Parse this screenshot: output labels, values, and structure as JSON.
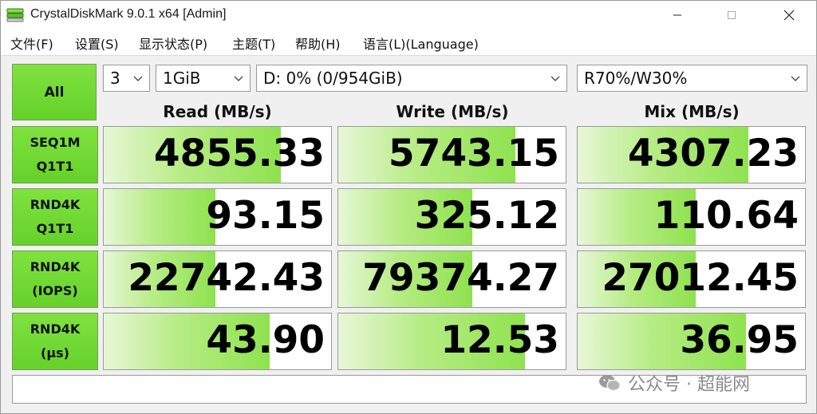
{
  "window": {
    "title": "CrystalDiskMark 9.0.1 x64 [Admin]"
  },
  "menu": {
    "items": [
      "文件(F)",
      "设置(S)",
      "显示状态(P)",
      "主题(T)",
      "帮助(H)",
      "语言(L)(Language)"
    ]
  },
  "controls": {
    "all_label": "All",
    "count": "3",
    "size": "1GiB",
    "drive": "D: 0% (0/954GiB)",
    "mix": "R70%/W30%"
  },
  "headers": {
    "read": "Read (MB/s)",
    "write": "Write (MB/s)",
    "mix": "Mix (MB/s)"
  },
  "rows": [
    {
      "line1": "SEQ1M",
      "line2": "Q1T1",
      "read": "4855.33",
      "write": "5743.15",
      "mix": "4307.23",
      "read_fill": 0.78,
      "write_fill": 0.78,
      "mix_fill": 0.75
    },
    {
      "line1": "RND4K",
      "line2": "Q1T1",
      "read": "93.15",
      "write": "325.12",
      "mix": "110.64",
      "read_fill": 0.49,
      "write_fill": 0.59,
      "mix_fill": 0.52
    },
    {
      "line1": "RND4K",
      "line2": "(IOPS)",
      "read": "22742.43",
      "write": "79374.27",
      "mix": "27012.45",
      "read_fill": 0.49,
      "write_fill": 0.59,
      "mix_fill": 0.52
    },
    {
      "line1": "RND4K",
      "line2": "(μs)",
      "read": "43.90",
      "write": "12.53",
      "mix": "36.95",
      "read_fill": 0.73,
      "write_fill": 0.82,
      "mix_fill": 0.74
    }
  ],
  "watermark": {
    "text": "公众号 · 超能网"
  },
  "colors": {
    "accent_green": "#7fe23f"
  }
}
